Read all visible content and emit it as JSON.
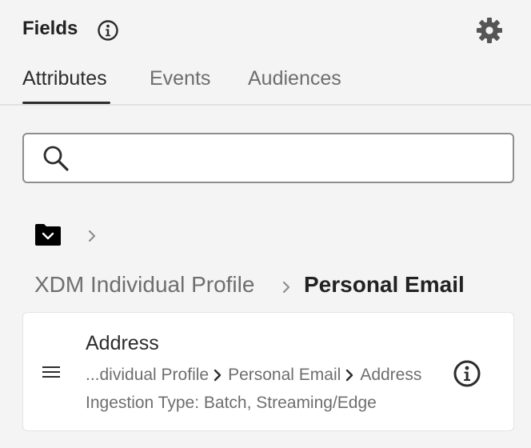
{
  "header": {
    "title": "Fields",
    "info_icon": "info-icon",
    "settings_icon": "gear-icon"
  },
  "tabs": [
    {
      "label": "Attributes",
      "active": true
    },
    {
      "label": "Events",
      "active": false
    },
    {
      "label": "Audiences",
      "active": false
    }
  ],
  "search": {
    "icon": "search-icon",
    "value": "",
    "placeholder": ""
  },
  "breadcrumb": {
    "root_icon": "folder-icon",
    "parent": "XDM Individual Profile",
    "current": "Personal Email"
  },
  "field_card": {
    "title": "Address",
    "path": [
      "...dividual Profile",
      "Personal Email",
      "Address"
    ],
    "ingestion": "Ingestion Type: Batch, Streaming/Edge",
    "handle_icon": "drag-handle-icon",
    "info_icon": "info-icon"
  },
  "colors": {
    "background": "#f4f4f4",
    "text": "#2c2c2c",
    "muted_text": "#6e6e6e",
    "border": "#8e8e8e",
    "card": "#ffffff"
  }
}
